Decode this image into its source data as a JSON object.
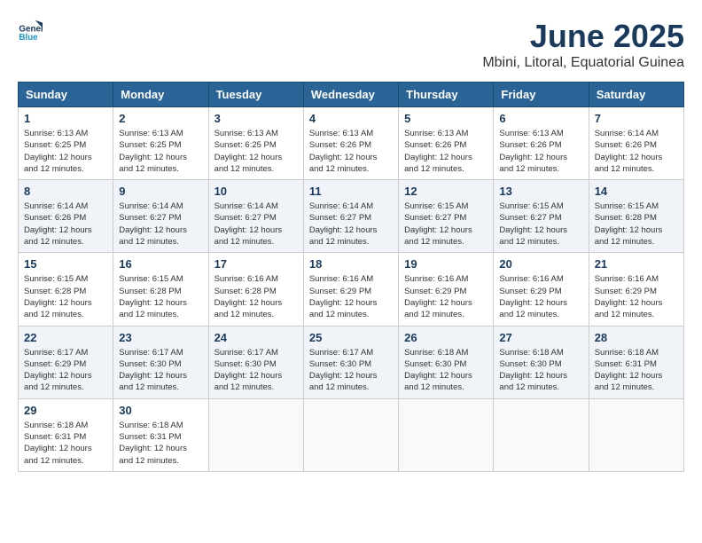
{
  "logo": {
    "line1": "General",
    "line2": "Blue"
  },
  "title": "June 2025",
  "location": "Mbini, Litoral, Equatorial Guinea",
  "headers": [
    "Sunday",
    "Monday",
    "Tuesday",
    "Wednesday",
    "Thursday",
    "Friday",
    "Saturday"
  ],
  "weeks": [
    [
      {
        "day": "1",
        "sunrise": "6:13 AM",
        "sunset": "6:25 PM",
        "daylight": "12 hours and 12 minutes."
      },
      {
        "day": "2",
        "sunrise": "6:13 AM",
        "sunset": "6:25 PM",
        "daylight": "12 hours and 12 minutes."
      },
      {
        "day": "3",
        "sunrise": "6:13 AM",
        "sunset": "6:25 PM",
        "daylight": "12 hours and 12 minutes."
      },
      {
        "day": "4",
        "sunrise": "6:13 AM",
        "sunset": "6:26 PM",
        "daylight": "12 hours and 12 minutes."
      },
      {
        "day": "5",
        "sunrise": "6:13 AM",
        "sunset": "6:26 PM",
        "daylight": "12 hours and 12 minutes."
      },
      {
        "day": "6",
        "sunrise": "6:13 AM",
        "sunset": "6:26 PM",
        "daylight": "12 hours and 12 minutes."
      },
      {
        "day": "7",
        "sunrise": "6:14 AM",
        "sunset": "6:26 PM",
        "daylight": "12 hours and 12 minutes."
      }
    ],
    [
      {
        "day": "8",
        "sunrise": "6:14 AM",
        "sunset": "6:26 PM",
        "daylight": "12 hours and 12 minutes."
      },
      {
        "day": "9",
        "sunrise": "6:14 AM",
        "sunset": "6:27 PM",
        "daylight": "12 hours and 12 minutes."
      },
      {
        "day": "10",
        "sunrise": "6:14 AM",
        "sunset": "6:27 PM",
        "daylight": "12 hours and 12 minutes."
      },
      {
        "day": "11",
        "sunrise": "6:14 AM",
        "sunset": "6:27 PM",
        "daylight": "12 hours and 12 minutes."
      },
      {
        "day": "12",
        "sunrise": "6:15 AM",
        "sunset": "6:27 PM",
        "daylight": "12 hours and 12 minutes."
      },
      {
        "day": "13",
        "sunrise": "6:15 AM",
        "sunset": "6:27 PM",
        "daylight": "12 hours and 12 minutes."
      },
      {
        "day": "14",
        "sunrise": "6:15 AM",
        "sunset": "6:28 PM",
        "daylight": "12 hours and 12 minutes."
      }
    ],
    [
      {
        "day": "15",
        "sunrise": "6:15 AM",
        "sunset": "6:28 PM",
        "daylight": "12 hours and 12 minutes."
      },
      {
        "day": "16",
        "sunrise": "6:15 AM",
        "sunset": "6:28 PM",
        "daylight": "12 hours and 12 minutes."
      },
      {
        "day": "17",
        "sunrise": "6:16 AM",
        "sunset": "6:28 PM",
        "daylight": "12 hours and 12 minutes."
      },
      {
        "day": "18",
        "sunrise": "6:16 AM",
        "sunset": "6:29 PM",
        "daylight": "12 hours and 12 minutes."
      },
      {
        "day": "19",
        "sunrise": "6:16 AM",
        "sunset": "6:29 PM",
        "daylight": "12 hours and 12 minutes."
      },
      {
        "day": "20",
        "sunrise": "6:16 AM",
        "sunset": "6:29 PM",
        "daylight": "12 hours and 12 minutes."
      },
      {
        "day": "21",
        "sunrise": "6:16 AM",
        "sunset": "6:29 PM",
        "daylight": "12 hours and 12 minutes."
      }
    ],
    [
      {
        "day": "22",
        "sunrise": "6:17 AM",
        "sunset": "6:29 PM",
        "daylight": "12 hours and 12 minutes."
      },
      {
        "day": "23",
        "sunrise": "6:17 AM",
        "sunset": "6:30 PM",
        "daylight": "12 hours and 12 minutes."
      },
      {
        "day": "24",
        "sunrise": "6:17 AM",
        "sunset": "6:30 PM",
        "daylight": "12 hours and 12 minutes."
      },
      {
        "day": "25",
        "sunrise": "6:17 AM",
        "sunset": "6:30 PM",
        "daylight": "12 hours and 12 minutes."
      },
      {
        "day": "26",
        "sunrise": "6:18 AM",
        "sunset": "6:30 PM",
        "daylight": "12 hours and 12 minutes."
      },
      {
        "day": "27",
        "sunrise": "6:18 AM",
        "sunset": "6:30 PM",
        "daylight": "12 hours and 12 minutes."
      },
      {
        "day": "28",
        "sunrise": "6:18 AM",
        "sunset": "6:31 PM",
        "daylight": "12 hours and 12 minutes."
      }
    ],
    [
      {
        "day": "29",
        "sunrise": "6:18 AM",
        "sunset": "6:31 PM",
        "daylight": "12 hours and 12 minutes."
      },
      {
        "day": "30",
        "sunrise": "6:18 AM",
        "sunset": "6:31 PM",
        "daylight": "12 hours and 12 minutes."
      },
      null,
      null,
      null,
      null,
      null
    ]
  ]
}
